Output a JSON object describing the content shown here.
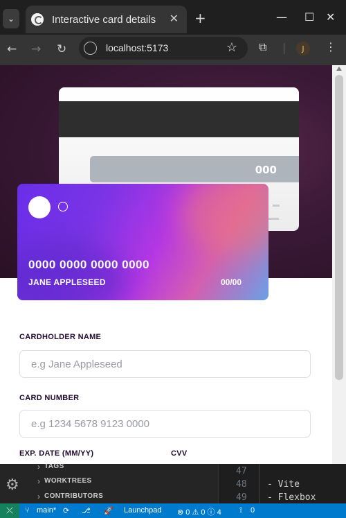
{
  "browser": {
    "tab_title": "Interactive card details",
    "tab_close": "✕",
    "new_tab": "+",
    "url": "localhost:5173",
    "profile_initial": "J",
    "controls": {
      "minimize": "—",
      "maximize": "☐",
      "close": "✕"
    }
  },
  "card_back": {
    "cvc": "000"
  },
  "card_front": {
    "number": "0000 0000 0000 0000",
    "holder": "JANE APPLESEED",
    "expiry": "00/00"
  },
  "form": {
    "name_label": "CARDHOLDER NAME",
    "name_placeholder": "e.g Jane Appleseed",
    "number_label": "CARD NUMBER",
    "number_placeholder": "e.g 1234 5678 9123 0000",
    "exp_label": "EXP. DATE (MM/YY)",
    "cvv_label": "CVV"
  },
  "vscode": {
    "panel_rows": [
      "TAGS",
      "WORKTREES",
      "CONTRIBUTORS"
    ],
    "lines": [
      {
        "num": "47",
        "text": ""
      },
      {
        "num": "48",
        "text": "- Vite"
      },
      {
        "num": "49",
        "text": "- Flexbox"
      }
    ],
    "status": {
      "branch": "main*",
      "launchpad": "Launchpad",
      "problems": "⊗ 0 ⚠ 0 ⓘ 4",
      "ports": "0"
    }
  },
  "colors": {
    "accent": "#007acc",
    "card_gradient_start": "#6a2ee8",
    "label_text": "#21092f"
  }
}
